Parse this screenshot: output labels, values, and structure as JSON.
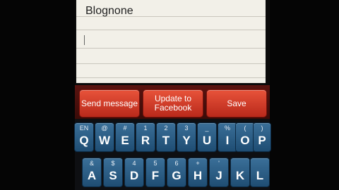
{
  "note": {
    "text": "Blognone"
  },
  "toolbar": {
    "send_label": "Send message",
    "update_label_1": "Update to",
    "update_label_2": "Facebook",
    "save_label": "Save"
  },
  "keyboard": {
    "row1": [
      {
        "top": "EN",
        "main": "Q"
      },
      {
        "top": "@",
        "main": "W"
      },
      {
        "top": "#",
        "main": "E"
      },
      {
        "top": "1",
        "main": "R"
      },
      {
        "top": "2",
        "main": "T"
      },
      {
        "top": "3",
        "main": "Y"
      },
      {
        "top": "_",
        "main": "U"
      },
      {
        "top": "%",
        "main": "I"
      },
      {
        "top": "(",
        "main": "O"
      },
      {
        "top": ")",
        "main": "P"
      }
    ],
    "row2": [
      {
        "top": "&",
        "main": "A"
      },
      {
        "top": "$",
        "main": "S"
      },
      {
        "top": "4",
        "main": "D"
      },
      {
        "top": "5",
        "main": "F"
      },
      {
        "top": "6",
        "main": "G"
      },
      {
        "top": "+",
        "main": "H"
      },
      {
        "top": "'",
        "main": "J"
      },
      {
        "top": "",
        "main": "K"
      },
      {
        "top": "",
        "main": "L"
      }
    ]
  },
  "colors": {
    "note_bg": "#f2f0e8",
    "toolbar_button": "#d13a26",
    "key": "#2b5d86"
  }
}
